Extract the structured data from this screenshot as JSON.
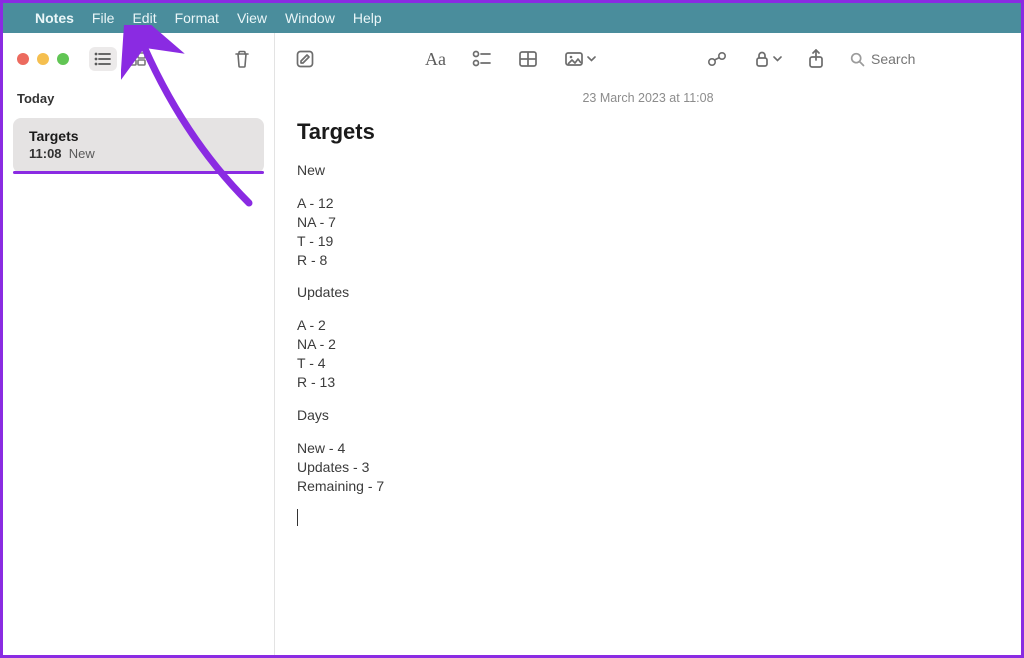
{
  "menubar": {
    "items": [
      "Notes",
      "File",
      "Edit",
      "Format",
      "View",
      "Window",
      "Help"
    ],
    "active_index": 0
  },
  "sidebar": {
    "section": "Today",
    "note": {
      "title": "Targets",
      "time": "11:08",
      "preview": "New"
    }
  },
  "toolbar": {
    "format_label": "Aa",
    "search_placeholder": "Search"
  },
  "note": {
    "timestamp": "23 March 2023 at 11:08",
    "title": "Targets",
    "body_blocks": [
      "New",
      "A - 12\nNA - 7\nT - 19\nR - 8",
      "Updates",
      "A - 2\nNA - 2\nT - 4\nR - 13",
      "Days",
      "New - 4\nUpdates - 3\nRemaining - 7"
    ]
  },
  "annotation": {
    "target": "file-menu"
  }
}
